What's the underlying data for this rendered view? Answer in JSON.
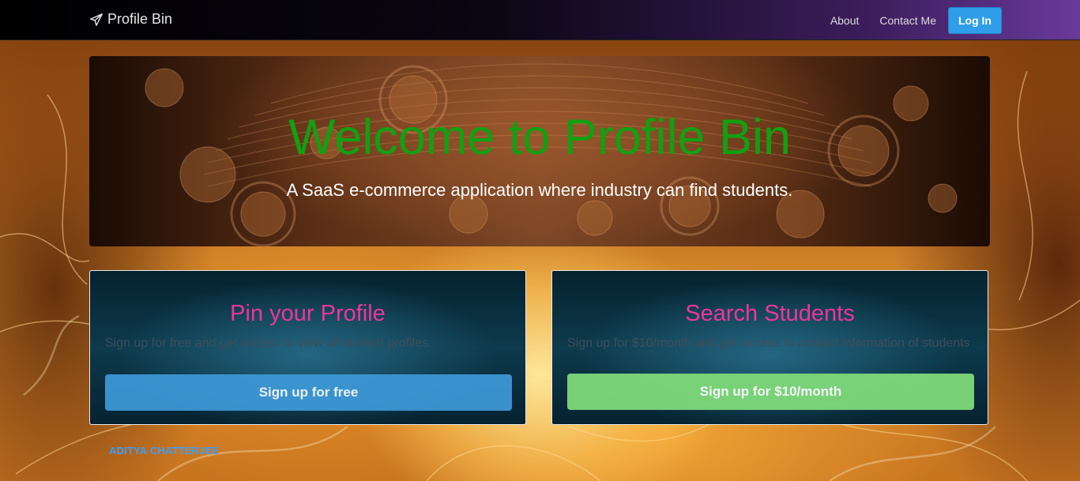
{
  "navbar": {
    "brand": "Profile Bin",
    "brand_icon": "paper-plane-icon",
    "links": [
      "About",
      "Contact Me"
    ],
    "login_label": "Log In"
  },
  "hero": {
    "title": "Welcome to Profile Bin",
    "subtitle": "A SaaS e-commerce application where industry can find students."
  },
  "cards": [
    {
      "title": "Pin your Profile",
      "text": "Sign up for free and get access to view all student profiles.",
      "button": "Sign up for free"
    },
    {
      "title": "Search Students",
      "text": "Sign up for $10/month and get access to contact information of students",
      "button": "Sign up for $10/month"
    }
  ],
  "footer": {
    "author": "ADITYA CHATTERJEE"
  },
  "colors": {
    "hero_title": "#11a012",
    "card_title": "#f0359a",
    "login_button": "#2f9ee8",
    "free_button": "#3e9ad9",
    "paid_button": "#7fd97a",
    "footer_name": "#3aa0ff"
  }
}
